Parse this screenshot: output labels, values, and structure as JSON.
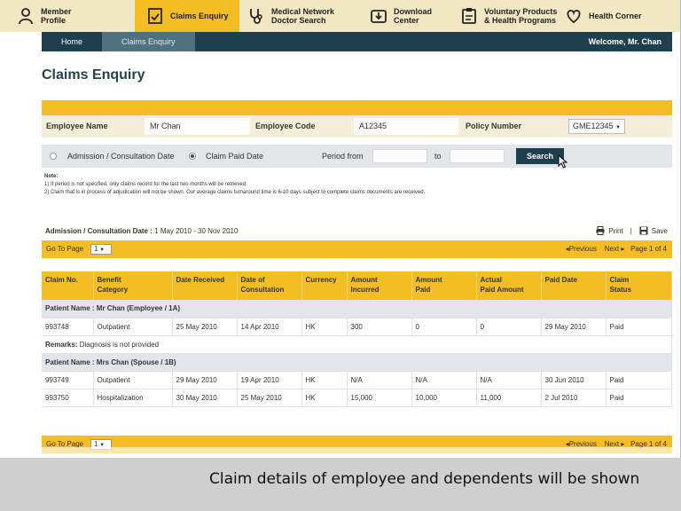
{
  "nav": [
    {
      "label_line1": "Member",
      "label_line2": "Profile",
      "icon": "person-icon",
      "active": false
    },
    {
      "label_line1": "Claims Enquiry",
      "label_line2": "",
      "icon": "document-icon",
      "active": true
    },
    {
      "label_line1": "Medical Network",
      "label_line2": "Doctor Search",
      "icon": "stethoscope-icon",
      "active": false
    },
    {
      "label_line1": "Download",
      "label_line2": "Center",
      "icon": "download-icon",
      "active": false
    },
    {
      "label_line1": "Voluntary Products",
      "label_line2": "& Health Programs",
      "icon": "clipboard-icon",
      "active": false
    },
    {
      "label_line1": "Health Corner",
      "label_line2": "",
      "icon": "heart-icon",
      "active": false
    }
  ],
  "subnav": {
    "home": "Home",
    "claims": "Claims Enquiry",
    "welcome": "Welcome, Mr. Chan"
  },
  "page_title": "Claims Enquiry",
  "filters": {
    "employee_name_label": "Employee Name",
    "employee_name": "Mr Chan",
    "employee_code_label": "Employee Code",
    "employee_code": "A12345",
    "policy_label": "Policy Number",
    "policy_value": "GME12345"
  },
  "date_filter": {
    "option1": "Admission / Consultation Date",
    "option2": "Claim Paid Date",
    "selected": "option2",
    "period_from": "Period from",
    "to": "to",
    "search": "Search"
  },
  "notes": {
    "title": "Note:",
    "line1": "1) If period is not specified, only claims record for the last two months will be retrieved.",
    "line2": "2) Claim that is in process of adjudication will not be shown. Our average claims turnaround time is 6-10 days subject to complete claims documents are received."
  },
  "period": {
    "label": "Admission / Consultation Date :",
    "value": "1 May 2010 - 30 Nov 2010"
  },
  "actions": {
    "print": "Print",
    "separator": "|",
    "save": "Save"
  },
  "pager": {
    "goto": "Go To Page",
    "page": "1",
    "previous": "Previous",
    "next": "Next",
    "page_of": "Page 1 of 4"
  },
  "table": {
    "headers": [
      [
        "Claim No.",
        ""
      ],
      [
        "Benefit",
        "Category"
      ],
      [
        "Date Received",
        ""
      ],
      [
        "Date of",
        "Consultation"
      ],
      [
        "Currency",
        ""
      ],
      [
        "Amount",
        "Incurred"
      ],
      [
        "Amount",
        "Paid"
      ],
      [
        "Actual",
        "Paid Amount"
      ],
      [
        "Paid Date",
        ""
      ],
      [
        "Claim",
        "Status"
      ]
    ],
    "group1": "Patient Name : Mr Chan (Employee / 1A)",
    "row1": [
      "993748",
      "Outpatient",
      "25 May 2010",
      "14 Apr 2010",
      "HK",
      "300",
      "0",
      "0",
      "29 May 2010",
      "Paid"
    ],
    "remark_label": "Remarks:",
    "remark_text": "Diagnosis is not provided",
    "group2": "Patient Name : Mrs Chan (Spouse / 1B)",
    "row2": [
      "993749",
      "Outpatient",
      "29 May 2010",
      "19 Apr 2010",
      "HK",
      "N/A",
      "N/A",
      "N/A",
      "30 Jun 2010",
      "Paid"
    ],
    "row3": [
      "993750",
      "Hospitalization",
      "30 May 2010",
      "25 May 2010",
      "HK",
      "15,000",
      "10,000",
      "11,000",
      "2 Jul 2010",
      "Paid"
    ]
  },
  "caption": "Claim details of employee and dependents will be shown",
  "colors": {
    "accent": "#f4bd24",
    "navy": "#1e3f4e"
  }
}
